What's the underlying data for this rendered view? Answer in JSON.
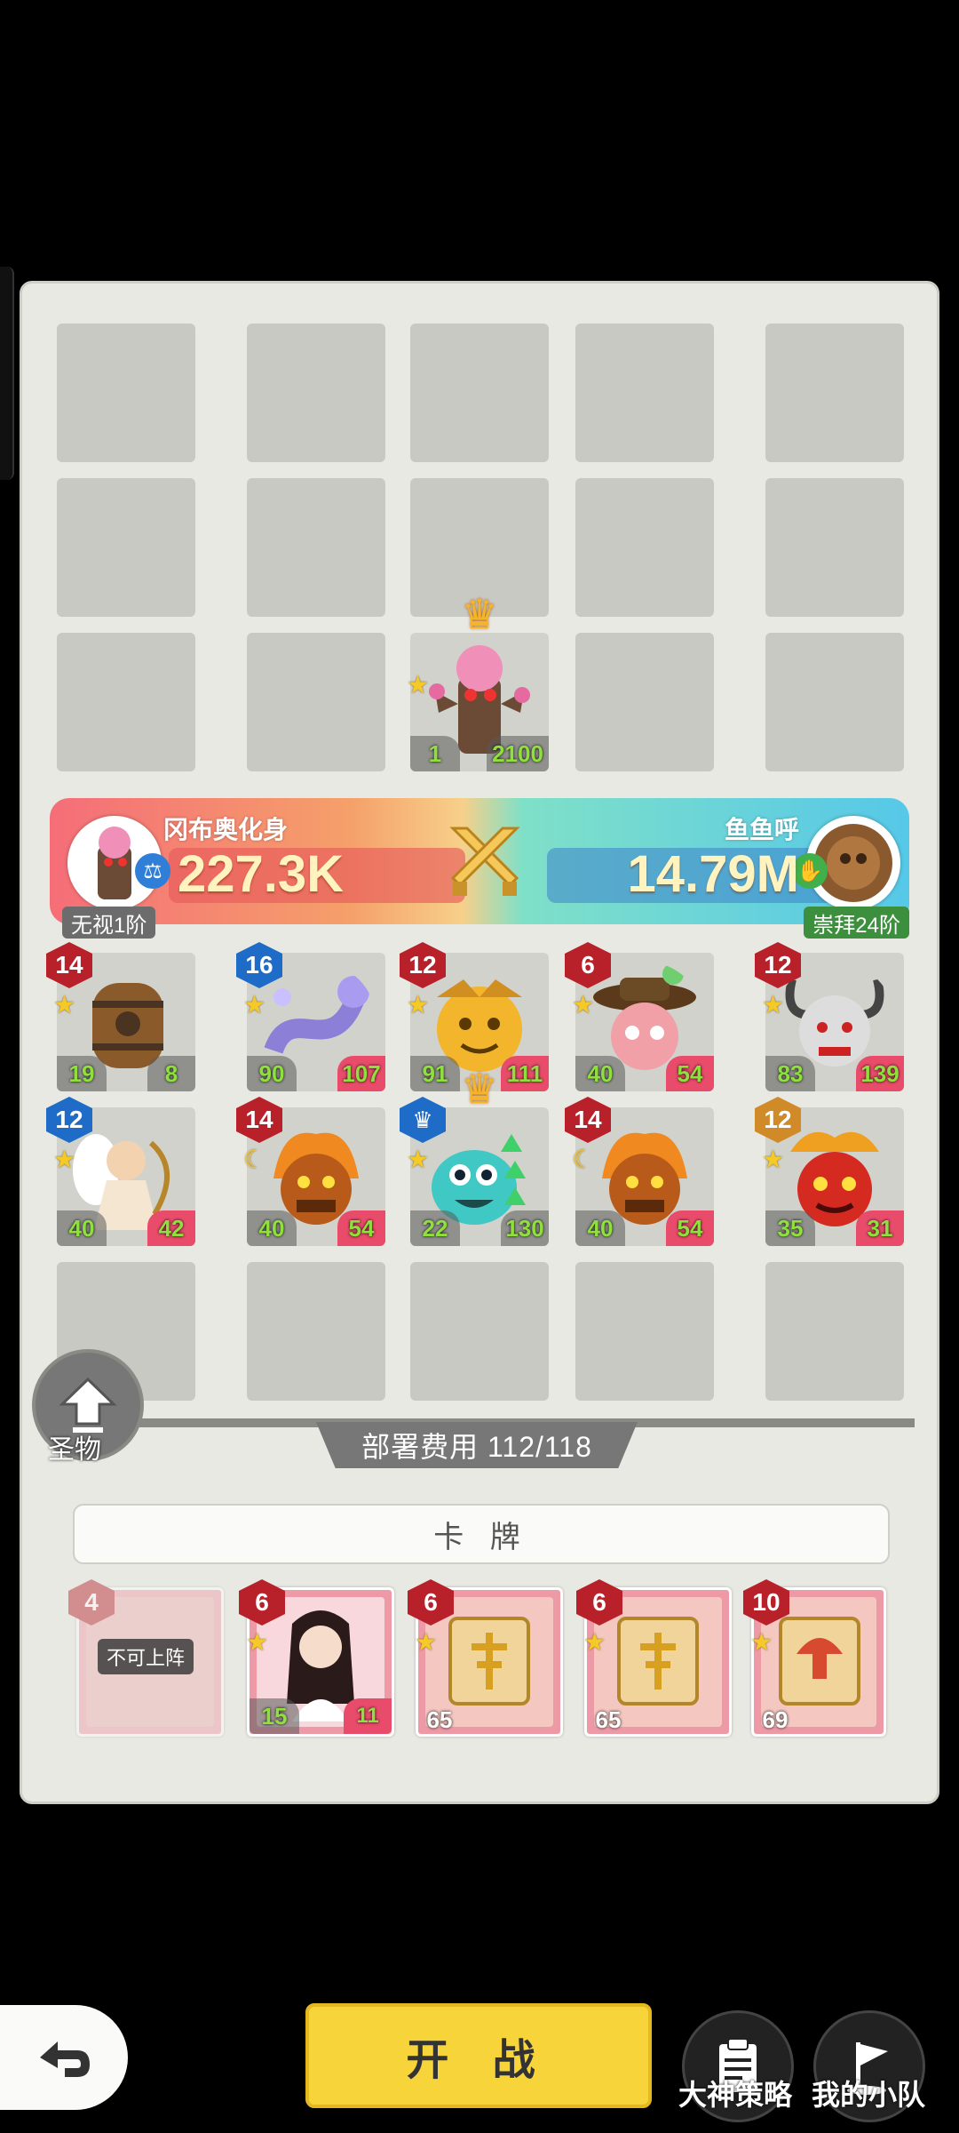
{
  "banner": {
    "player_left": {
      "name": "冈布奥化身",
      "power": "227.3K",
      "rank": "无视1阶"
    },
    "player_right": {
      "name": "鱼鱼呼",
      "power": "14.79M",
      "rank": "崇拜24阶"
    }
  },
  "board_units": {
    "top_unit": {
      "atk": "1",
      "hp": "2100"
    },
    "row1": [
      {
        "level": "14",
        "atk": "19",
        "hp": "8"
      },
      {
        "level": "16",
        "atk": "90",
        "hp": "107"
      },
      {
        "level": "12",
        "atk": "91",
        "hp": "111"
      },
      {
        "level": "6",
        "atk": "40",
        "hp": "54"
      },
      {
        "level": "12",
        "atk": "83",
        "hp": "139"
      }
    ],
    "row2": [
      {
        "level": "12",
        "atk": "40",
        "hp": "42"
      },
      {
        "level": "14",
        "atk": "40",
        "hp": "54"
      },
      {
        "level": "",
        "atk": "22",
        "hp": "130"
      },
      {
        "level": "14",
        "atk": "40",
        "hp": "54"
      },
      {
        "level": "12",
        "atk": "35",
        "hp": "31"
      }
    ]
  },
  "deploy": {
    "label": "部署费用 112/118"
  },
  "relic": {
    "label": "圣物"
  },
  "cards": {
    "header": "卡 牌",
    "items": [
      {
        "level": "4",
        "cost": "",
        "hp": "",
        "note": "不可上阵"
      },
      {
        "level": "6",
        "atk": "15",
        "hp": "11"
      },
      {
        "level": "6",
        "cost": "65"
      },
      {
        "level": "6",
        "cost": "65"
      },
      {
        "level": "10",
        "cost": "69"
      }
    ]
  },
  "footer": {
    "start": "开 战",
    "strategy": "大神策略",
    "team": "我的小队"
  },
  "colors": {
    "start_button": "#f7d43a",
    "board": "#e9e9e4"
  }
}
